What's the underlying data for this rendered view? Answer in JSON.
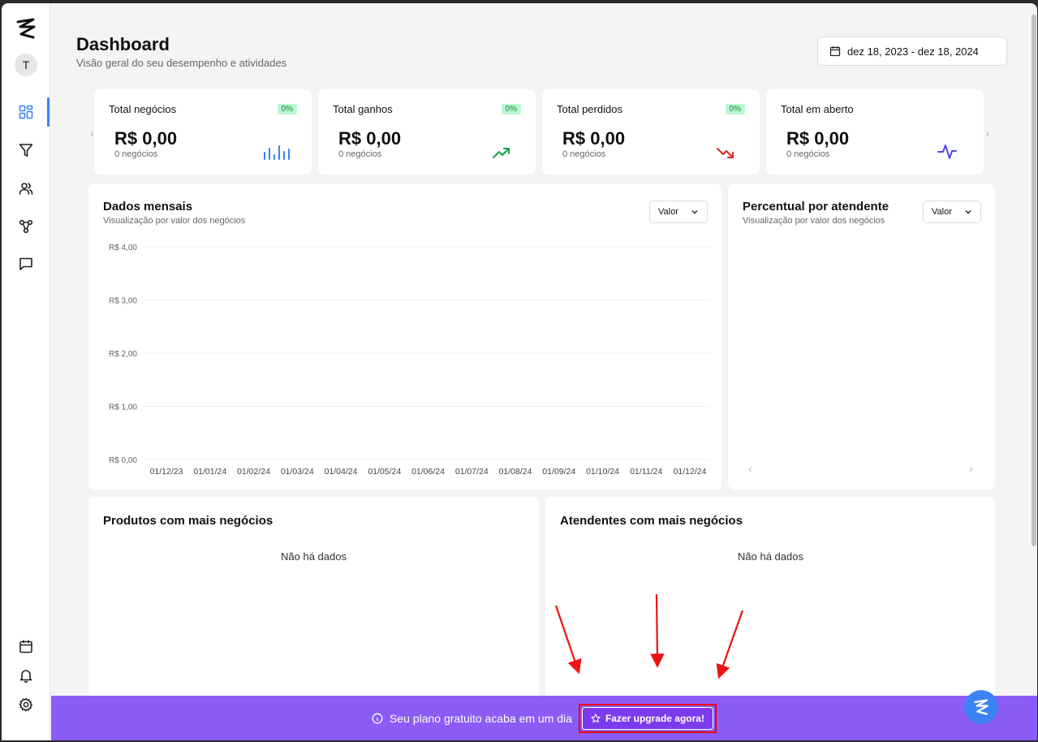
{
  "header": {
    "title": "Dashboard",
    "subtitle": "Visão geral do seu desempenho e atividades",
    "date_range": "dez 18, 2023 - dez 18, 2024"
  },
  "user": {
    "avatar_initial": "T"
  },
  "kpis": [
    {
      "title": "Total negócios",
      "badge": "0%",
      "value": "R$ 0,00",
      "count": "0 negócios",
      "icon": "bar-chart-icon",
      "color": "#3b82f6"
    },
    {
      "title": "Total ganhos",
      "badge": "0%",
      "value": "R$ 0,00",
      "count": "0 negócios",
      "icon": "trending-up-icon",
      "color": "#16a34a"
    },
    {
      "title": "Total perdidos",
      "badge": "0%",
      "value": "R$ 0,00",
      "count": "0 negócios",
      "icon": "trending-down-icon",
      "color": "#dc2626"
    },
    {
      "title": "Total em aberto",
      "badge": "",
      "value": "R$ 0,00",
      "count": "0 negócios",
      "icon": "activity-icon",
      "color": "#4f46e5"
    }
  ],
  "monthly": {
    "title": "Dados mensais",
    "subtitle": "Visualização por valor dos negócios",
    "select": "Valor"
  },
  "percent": {
    "title": "Percentual por atendente",
    "subtitle": "Visualização por valor dos negócios",
    "select": "Valor"
  },
  "products": {
    "title": "Produtos com mais negócios",
    "empty": "Não há dados"
  },
  "agents": {
    "title": "Atendentes com mais negócios",
    "empty": "Não há dados"
  },
  "banner": {
    "message": "Seu plano gratuito acaba em um dia",
    "button": "Fazer upgrade agora!"
  },
  "chart_data": {
    "type": "line",
    "title": "",
    "xlabel": "",
    "ylabel": "",
    "x": [
      "01/12/23",
      "01/01/24",
      "01/02/24",
      "01/03/24",
      "01/04/24",
      "01/05/24",
      "01/06/24",
      "01/07/24",
      "01/08/24",
      "01/09/24",
      "01/10/24",
      "01/11/24",
      "01/12/24"
    ],
    "yticks": [
      "R$ 0,00",
      "R$ 1,00",
      "R$ 2,00",
      "R$ 3,00",
      "R$ 4,00"
    ],
    "ylim": [
      0,
      4
    ],
    "series": [],
    "grid": true
  }
}
